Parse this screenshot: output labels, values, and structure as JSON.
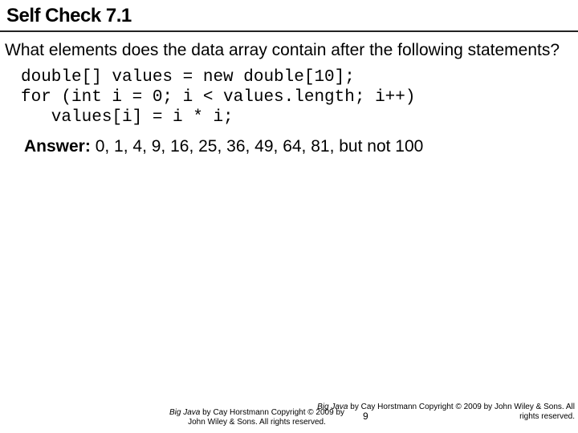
{
  "header": {
    "title": "Self Check 7.1"
  },
  "body": {
    "question": "What elements does the data array contain after the following statements?",
    "code": "double[] values = new double[10];\nfor (int i = 0; i < values.length; i++)\n   values[i] = i * i;",
    "answer_label": "Answer:",
    "answer_text": " 0, 1, 4, 9, 16, 25, 36, 49, 64, 81, but not 100"
  },
  "footer": {
    "left_book": "Big Java",
    "left_rest": " by Cay Horstmann Copyright © 2009 by John Wiley & Sons. All rights reserved.",
    "right_book": "Big Java",
    "right_rest": " by Cay Horstmann Copyright © 2009 by John Wiley & Sons. All rights reserved.",
    "page": "9"
  }
}
